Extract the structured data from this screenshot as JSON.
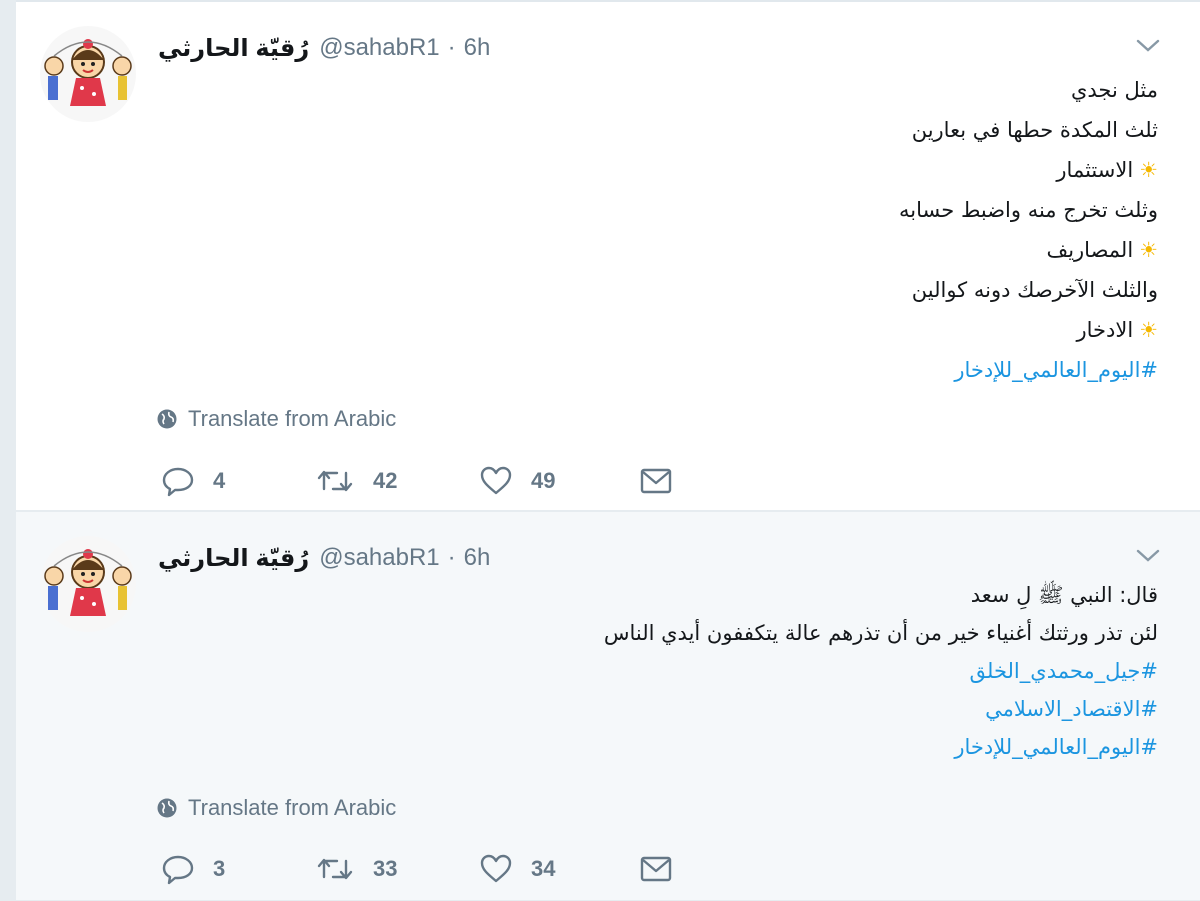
{
  "tweets": [
    {
      "author_name": "رُقيّة الحارثي",
      "handle": "@sahabR1",
      "separator": "·",
      "time": "6h",
      "lines": [
        {
          "type": "text",
          "text": "مثل نجدي"
        },
        {
          "type": "text",
          "text": "ثلث المكدة حطها في بعارين"
        },
        {
          "type": "sun",
          "text": "الاستثمار"
        },
        {
          "type": "text",
          "text": "وثلث تخرج منه واضبط حسابه"
        },
        {
          "type": "sun",
          "text": "المصاريف"
        },
        {
          "type": "text",
          "text": "والثلث الآخرصك دونه كوالين"
        },
        {
          "type": "sun",
          "text": "الادخار"
        },
        {
          "type": "hashtag",
          "text": "#اليوم_العالمي_للإدخار"
        }
      ],
      "translate_label": "Translate from Arabic",
      "reply_count": "4",
      "retweet_count": "42",
      "like_count": "49"
    },
    {
      "author_name": "رُقيّة الحارثي",
      "handle": "@sahabR1",
      "separator": "·",
      "time": "6h",
      "lines": [
        {
          "type": "text",
          "text": "قال: النبي ﷺ لِ سعد"
        },
        {
          "type": "text",
          "text": "لئن تذر ورثتك أغنياء خير من أن تذرهم عالة يتكففون أيدي الناس"
        },
        {
          "type": "hashtag",
          "text": "#جيل_محمدي_الخلق"
        },
        {
          "type": "hashtag",
          "text": "#الاقتصاد_الاسلامي"
        },
        {
          "type": "hashtag",
          "text": "#اليوم_العالمي_للإدخار"
        }
      ],
      "translate_label": "Translate from Arabic",
      "reply_count": "3",
      "retweet_count": "33",
      "like_count": "34"
    }
  ],
  "icons": {
    "sun": "sun-icon",
    "globe": "globe-icon",
    "reply": "reply-icon",
    "retweet": "retweet-icon",
    "like": "heart-icon",
    "message": "envelope-icon",
    "caret": "chevron-down-icon"
  },
  "colors": {
    "hashtag": "#1b95e0",
    "muted": "#657786",
    "sun": "#f5b800",
    "page_bg": "#e6ecf0"
  }
}
